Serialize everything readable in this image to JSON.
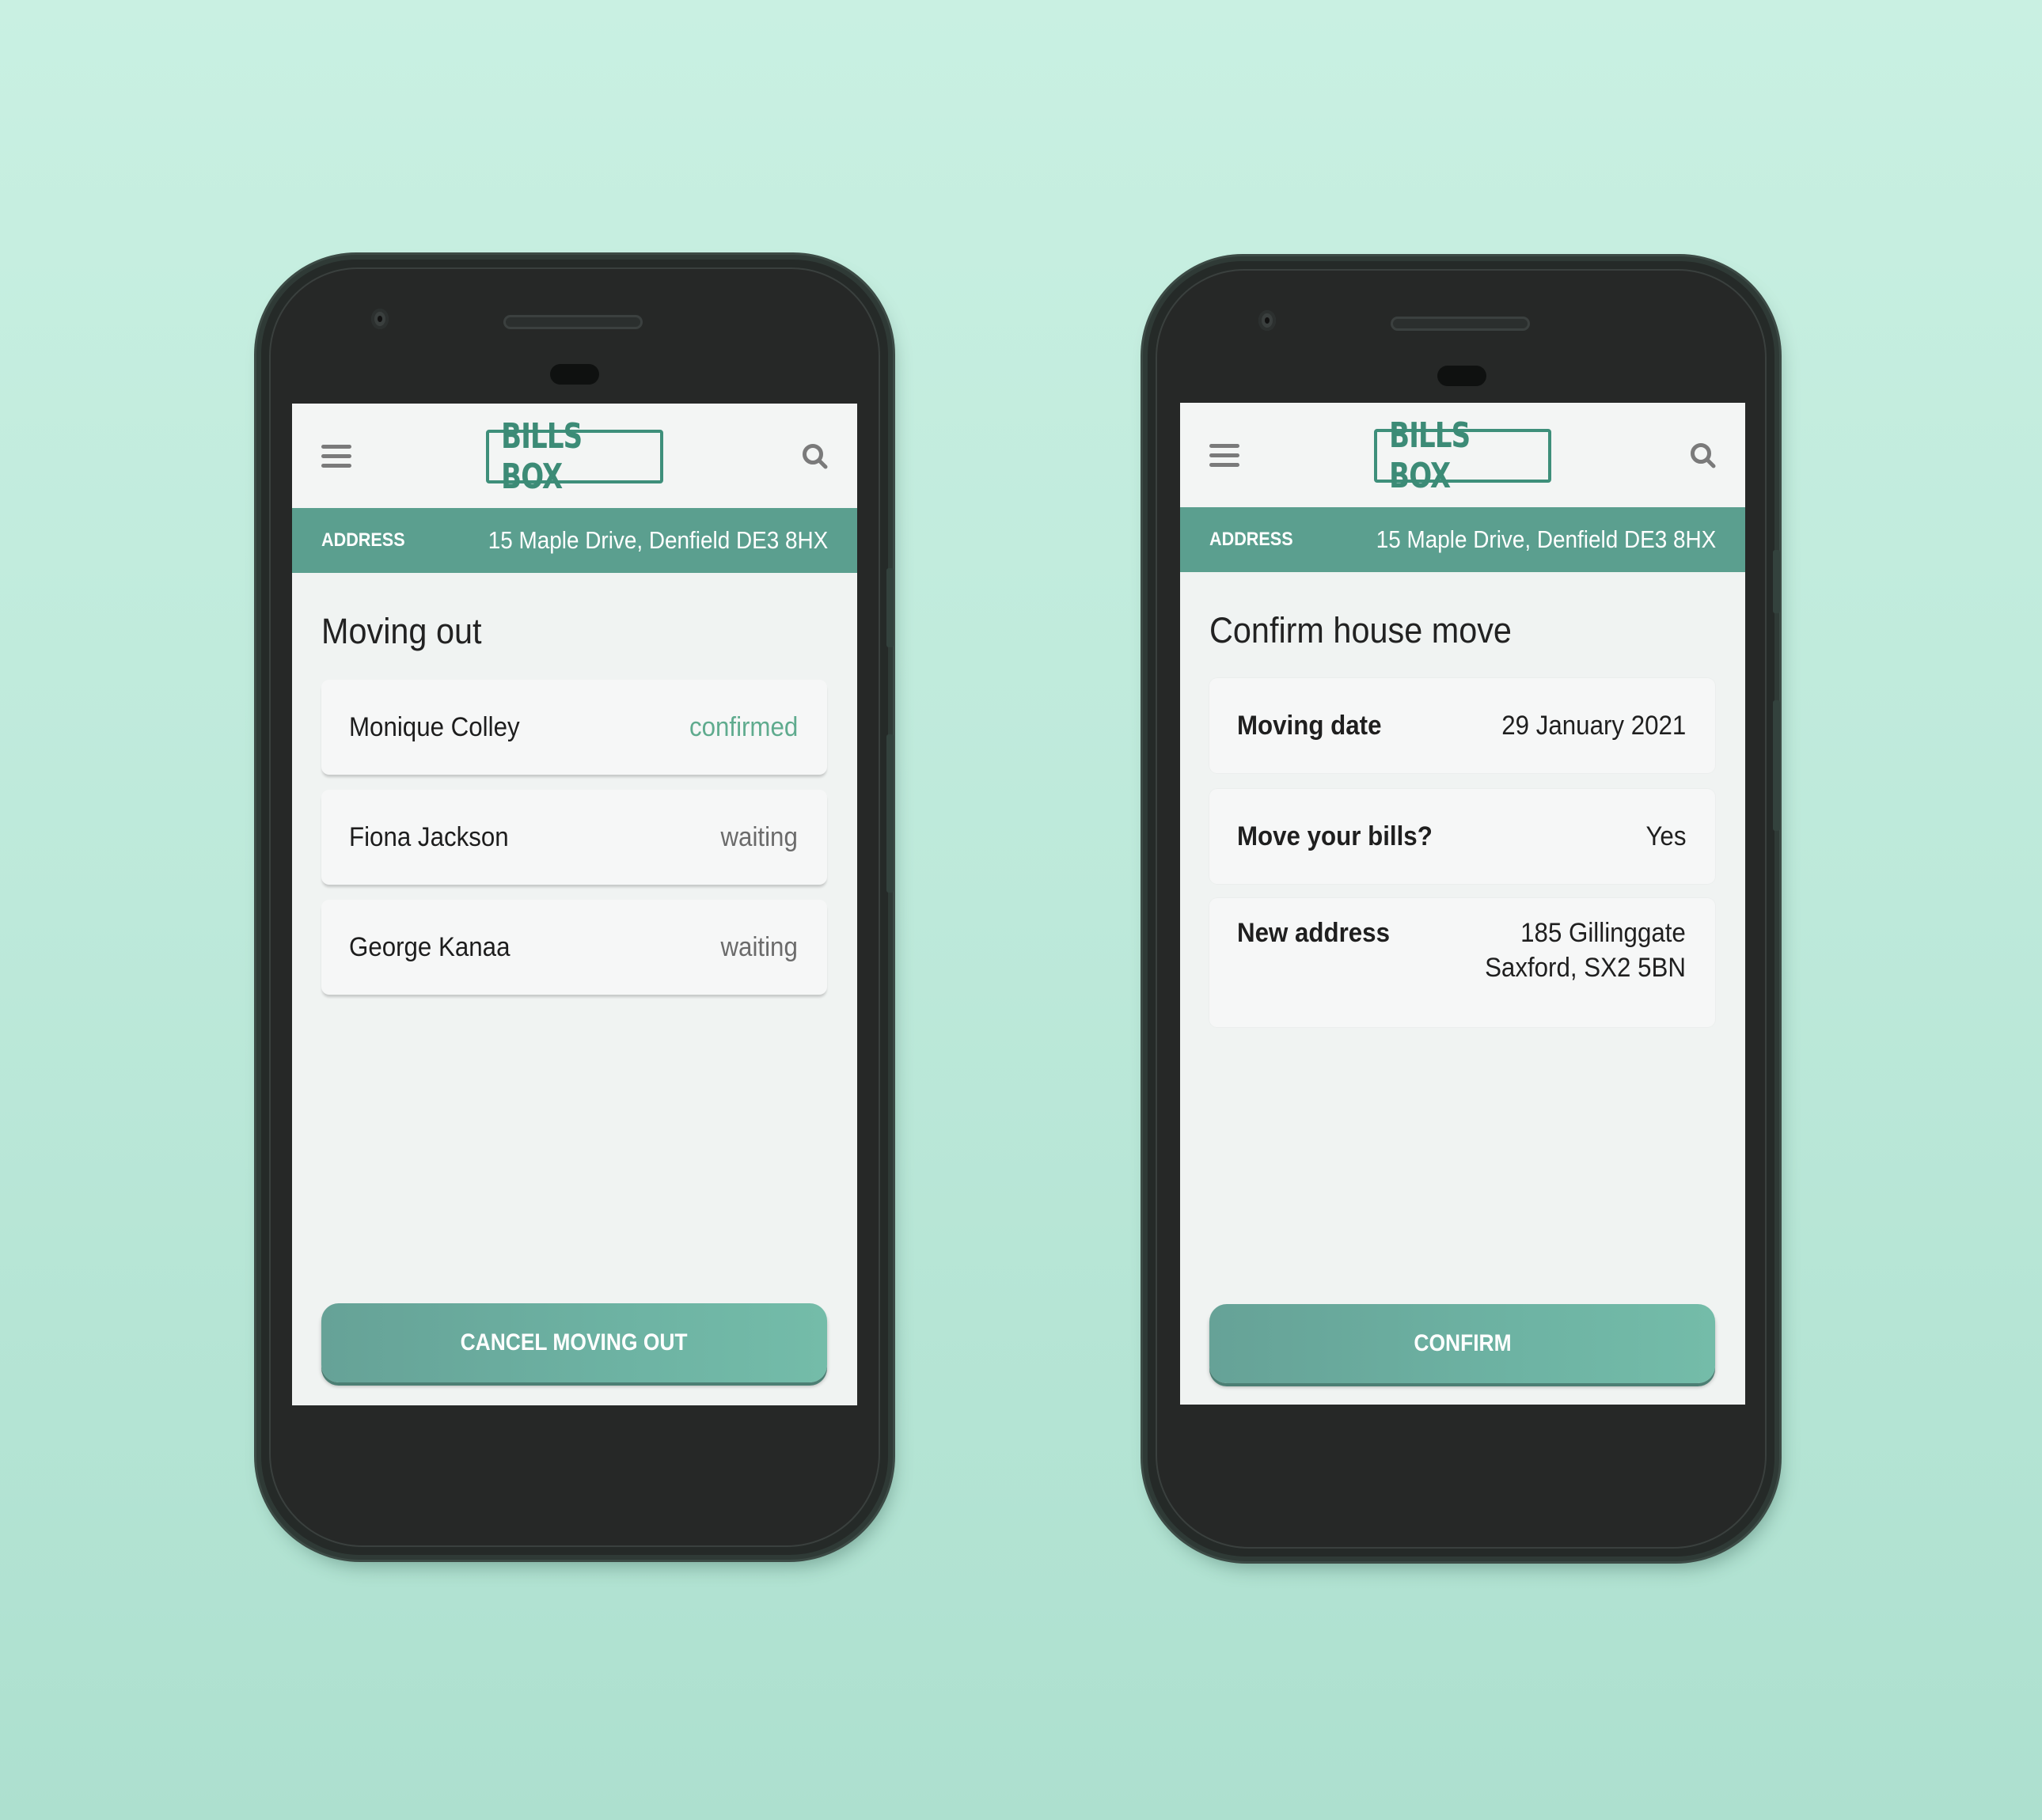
{
  "colors": {
    "background": "#c2ecdd",
    "brand_teal": "#3e8f7a",
    "address_bar": "#5b9f8f",
    "button": "#6db3a3",
    "confirmed_status": "#5fab8e",
    "waiting_status": "#6b6b6b"
  },
  "phones": [
    {
      "header": {
        "menu_icon": "hamburger-menu-icon",
        "logo": "BILLS BOX",
        "search_icon": "search-icon"
      },
      "address_bar": {
        "label": "ADDRESS",
        "value": "15 Maple Drive, Denfield DE3 8HX"
      },
      "title": "Moving out",
      "rows": [
        {
          "name": "Monique Colley",
          "status": "confirmed"
        },
        {
          "name": "Fiona Jackson",
          "status": "waiting"
        },
        {
          "name": "George Kanaa",
          "status": "waiting"
        }
      ],
      "button": "CANCEL MOVING OUT"
    },
    {
      "header": {
        "menu_icon": "hamburger-menu-icon",
        "logo": "BILLS BOX",
        "search_icon": "search-icon"
      },
      "address_bar": {
        "label": "ADDRESS",
        "value": "15 Maple Drive, Denfield DE3 8HX"
      },
      "title": "Confirm house move",
      "rows": [
        {
          "label": "Moving date",
          "value": "29 January 2021"
        },
        {
          "label": "Move your bills?",
          "value": "Yes"
        },
        {
          "label": "New address",
          "value_line1": "185 Gillinggate",
          "value_line2": "Saxford, SX2 5BN"
        }
      ],
      "button": "CONFIRM"
    }
  ]
}
